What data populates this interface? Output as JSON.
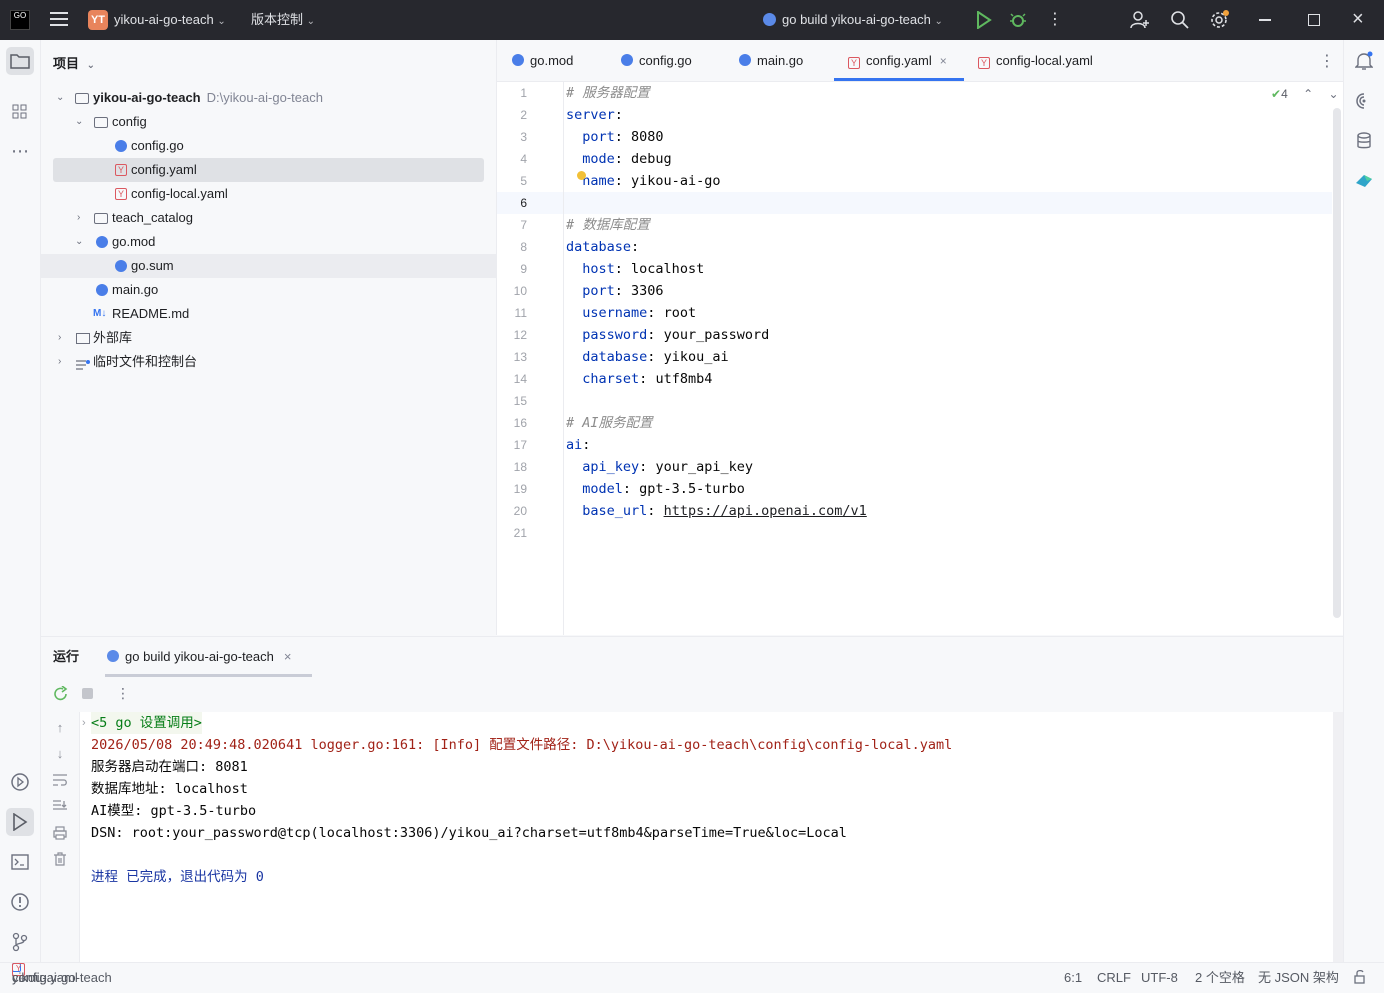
{
  "titlebar": {
    "logo": "GO",
    "project_badge": "YT",
    "project_name": "yikou-ai-go-teach",
    "vcs_label": "版本控制",
    "run_config": "go build yikou-ai-go-teach",
    "icons": [
      "hamburger-icon",
      "run-icon",
      "debug-icon",
      "more-icon",
      "add-user-icon",
      "search-icon",
      "settings-icon",
      "minimize-icon",
      "maximize-icon",
      "close-icon"
    ]
  },
  "project_panel": {
    "title": "项目",
    "tree": [
      {
        "label": "yikou-ai-go-teach",
        "path": "D:\\yikou-ai-go-teach"
      },
      {
        "label": "config"
      },
      {
        "label": "config.go"
      },
      {
        "label": "config.yaml"
      },
      {
        "label": "config-local.yaml"
      },
      {
        "label": "teach_catalog"
      },
      {
        "label": "go.mod"
      },
      {
        "label": "go.sum"
      },
      {
        "label": "main.go"
      },
      {
        "label": "README.md",
        "icon_text": "M↓"
      },
      {
        "label": "外部库"
      },
      {
        "label": "临时文件和控制台"
      }
    ]
  },
  "tabs": [
    {
      "label": "go.mod"
    },
    {
      "label": "config.go"
    },
    {
      "label": "main.go"
    },
    {
      "label": "config.yaml",
      "close": "×"
    },
    {
      "label": "config-local.yaml"
    }
  ],
  "editor": {
    "inspection_count": "4",
    "line_numbers": [
      "1",
      "2",
      "3",
      "4",
      "5",
      "6",
      "7",
      "8",
      "9",
      "10",
      "11",
      "12",
      "13",
      "14",
      "15",
      "16",
      "17",
      "18",
      "19",
      "20",
      "21"
    ],
    "lines": [
      {
        "comment": "# 服务器配置"
      },
      {
        "key": "server",
        "sep": ":"
      },
      {
        "indent": "  ",
        "key": "port",
        "sep": ": ",
        "value": "8080"
      },
      {
        "indent": "  ",
        "key": "mode",
        "sep": ": ",
        "value": "debug"
      },
      {
        "indent": "  ",
        "key": "name",
        "sep": ": ",
        "value": "yikou-ai-go"
      },
      {},
      {
        "comment": "# 数据库配置"
      },
      {
        "key": "database",
        "sep": ":"
      },
      {
        "indent": "  ",
        "key": "host",
        "sep": ": ",
        "value": "localhost"
      },
      {
        "indent": "  ",
        "key": "port",
        "sep": ": ",
        "value": "3306"
      },
      {
        "indent": "  ",
        "key": "username",
        "sep": ": ",
        "value": "root"
      },
      {
        "indent": "  ",
        "key": "password",
        "sep": ": ",
        "value": "your_password"
      },
      {
        "indent": "  ",
        "key": "database",
        "sep": ": ",
        "value": "yikou_ai"
      },
      {
        "indent": "  ",
        "key": "charset",
        "sep": ": ",
        "value": "utf8mb4"
      },
      {},
      {
        "comment": "# AI服务配置"
      },
      {
        "key": "ai",
        "sep": ":"
      },
      {
        "indent": "  ",
        "key": "api_key",
        "sep": ": ",
        "value": "your_api_key"
      },
      {
        "indent": "  ",
        "key": "model",
        "sep": ": ",
        "value": "gpt-3.5-turbo"
      },
      {
        "indent": "  ",
        "key": "base_url",
        "sep": ": ",
        "value": "https://api.openai.com/v1"
      },
      {}
    ]
  },
  "run_panel": {
    "title": "运行",
    "tab_label": "go build yikou-ai-go-teach",
    "tab_close": "×",
    "console": [
      "<5 go 设置调用>",
      "2026/05/08 20:49:48.020641 logger.go:161: [Info] 配置文件路径: D:\\yikou-ai-go-teach\\config\\config-local.yaml",
      "服务器启动在端口: 8081",
      "数据库地址: localhost",
      "AI模型: gpt-3.5-turbo",
      "DSN: root:your_password@tcp(localhost:3306)/yikou_ai?charset=utf8mb4&parseTime=True&loc=Local",
      "",
      "进程 已完成，退出代码为 0"
    ]
  },
  "statusbar": {
    "breadcrumb": [
      "yikou-ai-go-teach",
      "config",
      "config.yaml"
    ],
    "position": "6:1",
    "line_sep": "CRLF",
    "encoding": "UTF-8",
    "indent": "2 个空格",
    "schema": "无 JSON 架构"
  },
  "colors": {
    "accent": "#3574f0",
    "titlebar": "#27282e",
    "yaml_key": "#0033b3",
    "yaml_value": "#067d17",
    "run_green": "#4aa34a"
  }
}
